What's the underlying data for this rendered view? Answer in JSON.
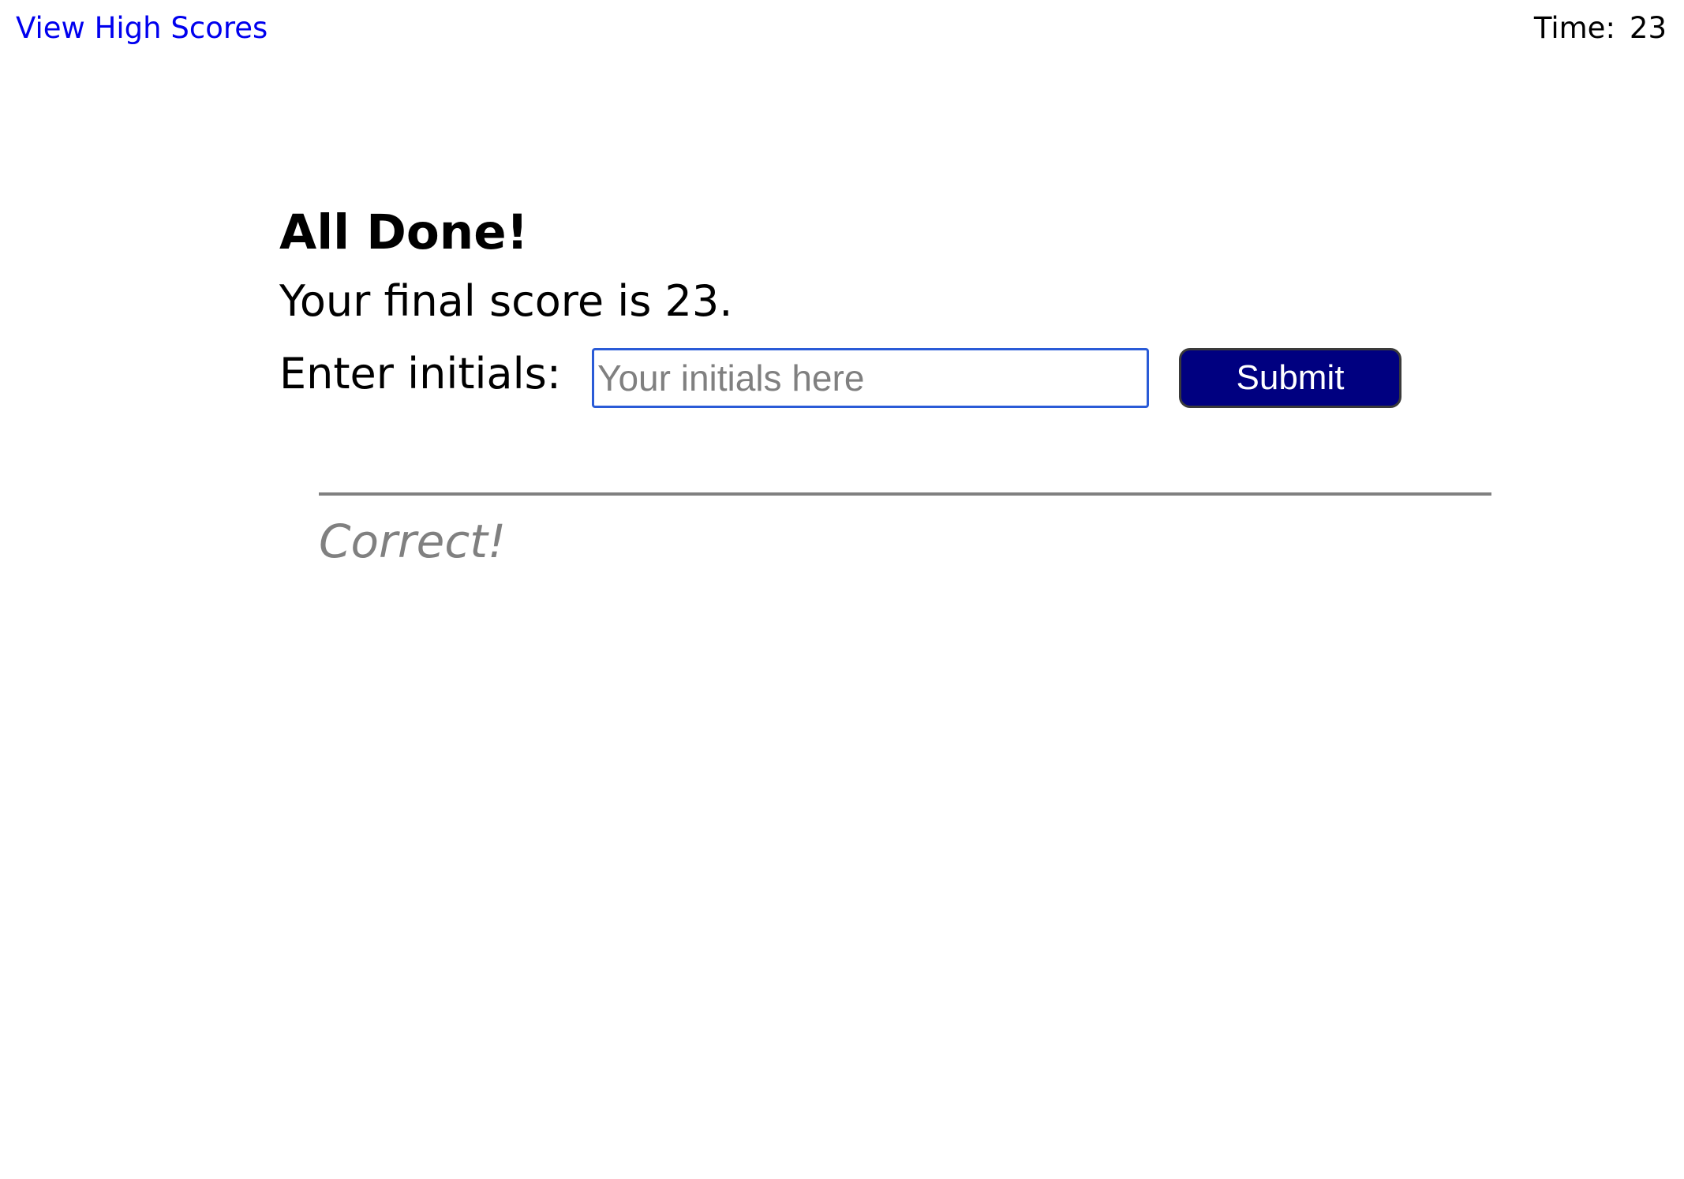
{
  "header": {
    "high_scores_link": "View High Scores",
    "timer_label": "Time:",
    "timer_value": "23"
  },
  "main": {
    "title": "All Done!",
    "score_text": "Your final score is 23.",
    "initials_label": "Enter initials:",
    "initials_placeholder": "Your initials here",
    "initials_value": "",
    "submit_label": "Submit"
  },
  "feedback": {
    "text": "Correct!"
  },
  "colors": {
    "link": "#0000ee",
    "button_bg": "#000080",
    "feedback_text": "#808080",
    "input_border": "#2a5bd7"
  }
}
